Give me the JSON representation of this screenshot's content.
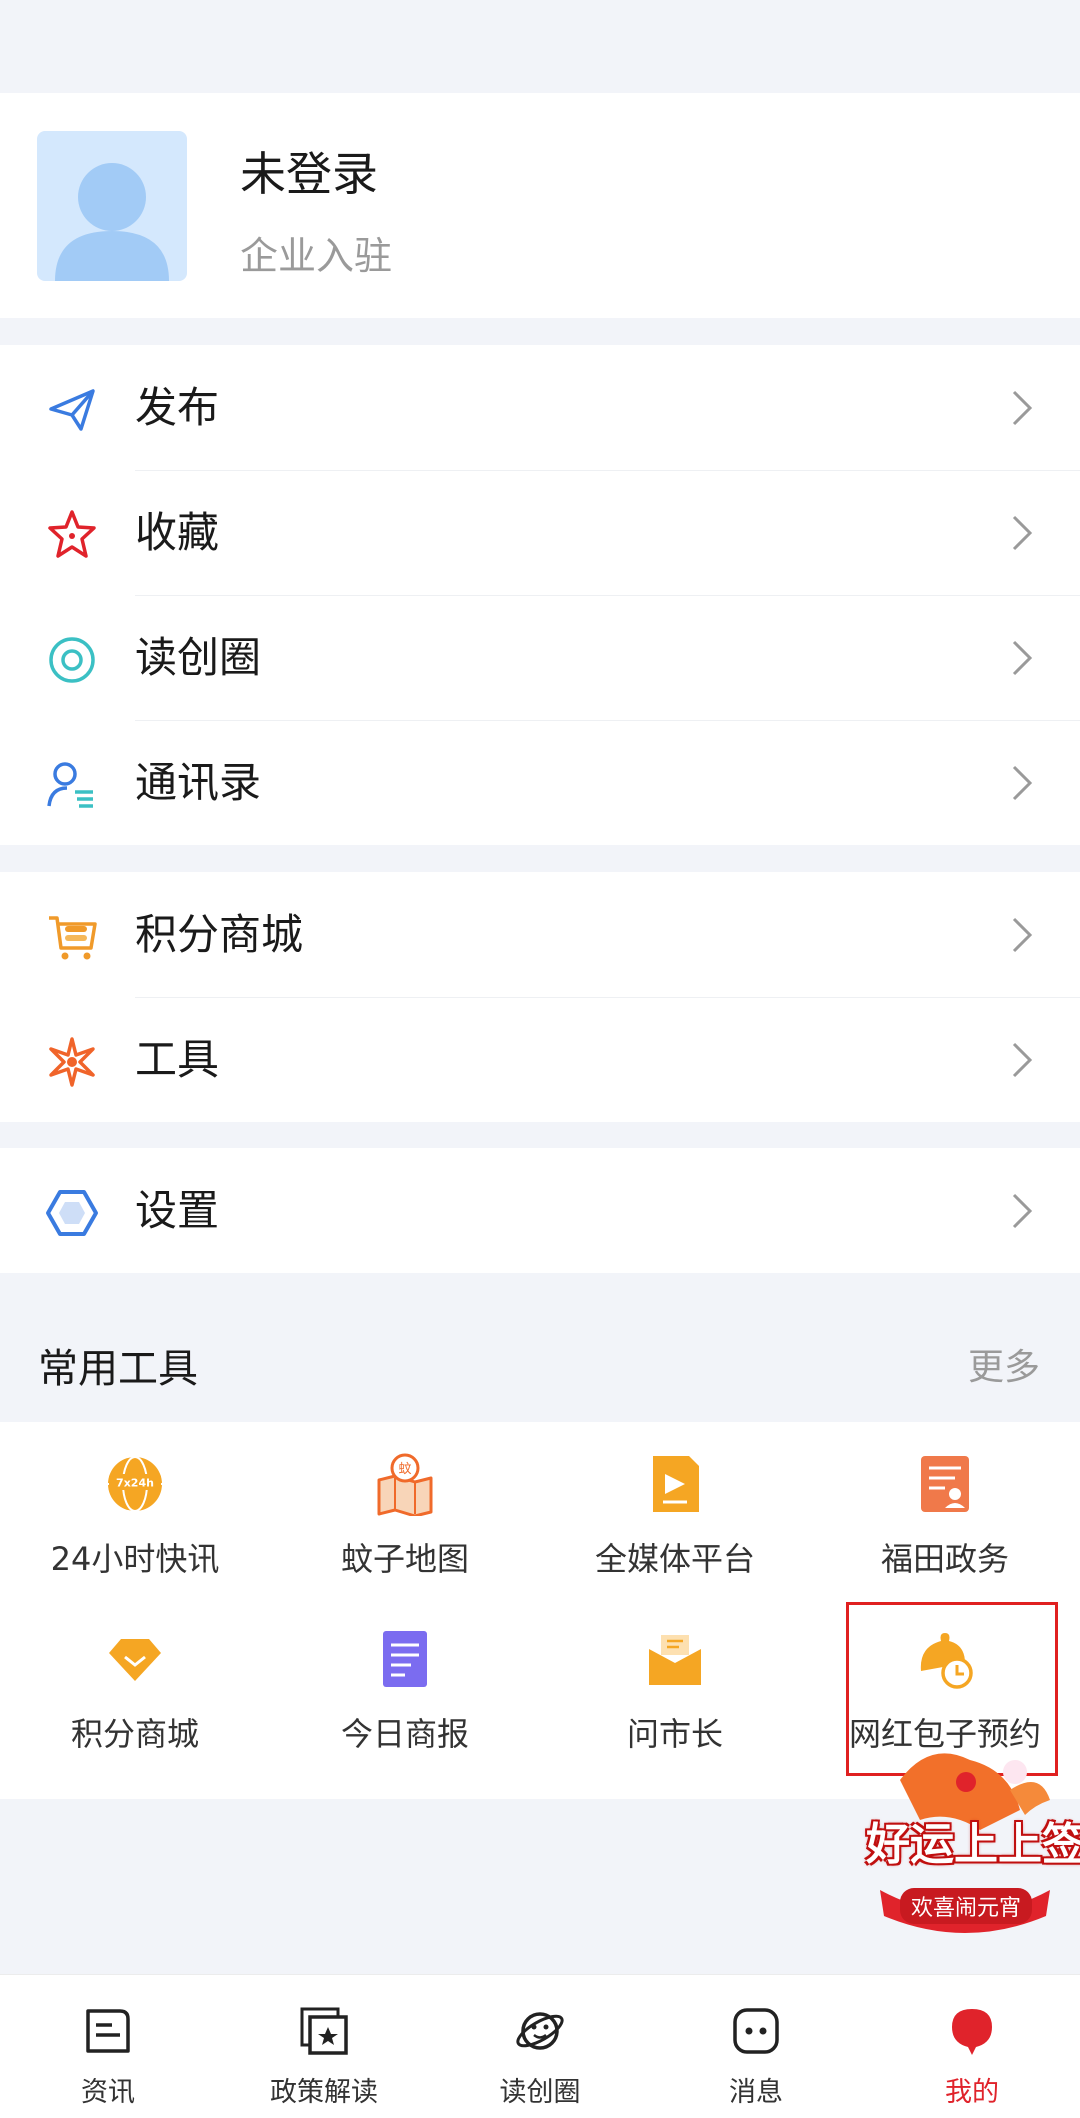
{
  "profile": {
    "name": "未登录",
    "sub": "企业入驻"
  },
  "menu1": [
    {
      "label": "发布",
      "icon": "send-icon"
    },
    {
      "label": "收藏",
      "icon": "star-icon"
    },
    {
      "label": "读创圈",
      "icon": "circle-icon"
    },
    {
      "label": "通讯录",
      "icon": "contacts-icon"
    }
  ],
  "menu2": [
    {
      "label": "积分商城",
      "icon": "shop-cart-icon"
    },
    {
      "label": "工具",
      "icon": "tools-icon"
    }
  ],
  "menu3": [
    {
      "label": "设置",
      "icon": "settings-hexagon-icon"
    }
  ],
  "tools_section": {
    "title": "常用工具",
    "more": "更多"
  },
  "tools": [
    {
      "label": "24小时快讯",
      "icon": "globe-24h-icon",
      "badge": "7x24h"
    },
    {
      "label": "蚊子地图",
      "icon": "map-icon",
      "badge": "蚊"
    },
    {
      "label": "全媒体平台",
      "icon": "media-platform-icon"
    },
    {
      "label": "福田政务",
      "icon": "government-icon"
    },
    {
      "label": "积分商城",
      "icon": "diamond-icon"
    },
    {
      "label": "今日商报",
      "icon": "newspaper-icon"
    },
    {
      "label": "问市长",
      "icon": "mail-icon"
    },
    {
      "label": "网红包子预约",
      "icon": "bun-clock-icon"
    }
  ],
  "promo": {
    "title": "好运上上签",
    "subtitle": "欢喜闹元宵"
  },
  "tabbar": [
    {
      "label": "资讯",
      "icon": "news-icon",
      "active": false
    },
    {
      "label": "政策解读",
      "icon": "policy-icon",
      "active": false
    },
    {
      "label": "读创圈",
      "icon": "planet-icon",
      "active": false
    },
    {
      "label": "消息",
      "icon": "message-icon",
      "active": false
    },
    {
      "label": "我的",
      "icon": "profile-tab-icon",
      "active": true
    }
  ],
  "colors": {
    "accent": "#e0232b",
    "blue": "#3a7be0",
    "orange": "#f09a2a",
    "highlight_box": "#e02020"
  }
}
